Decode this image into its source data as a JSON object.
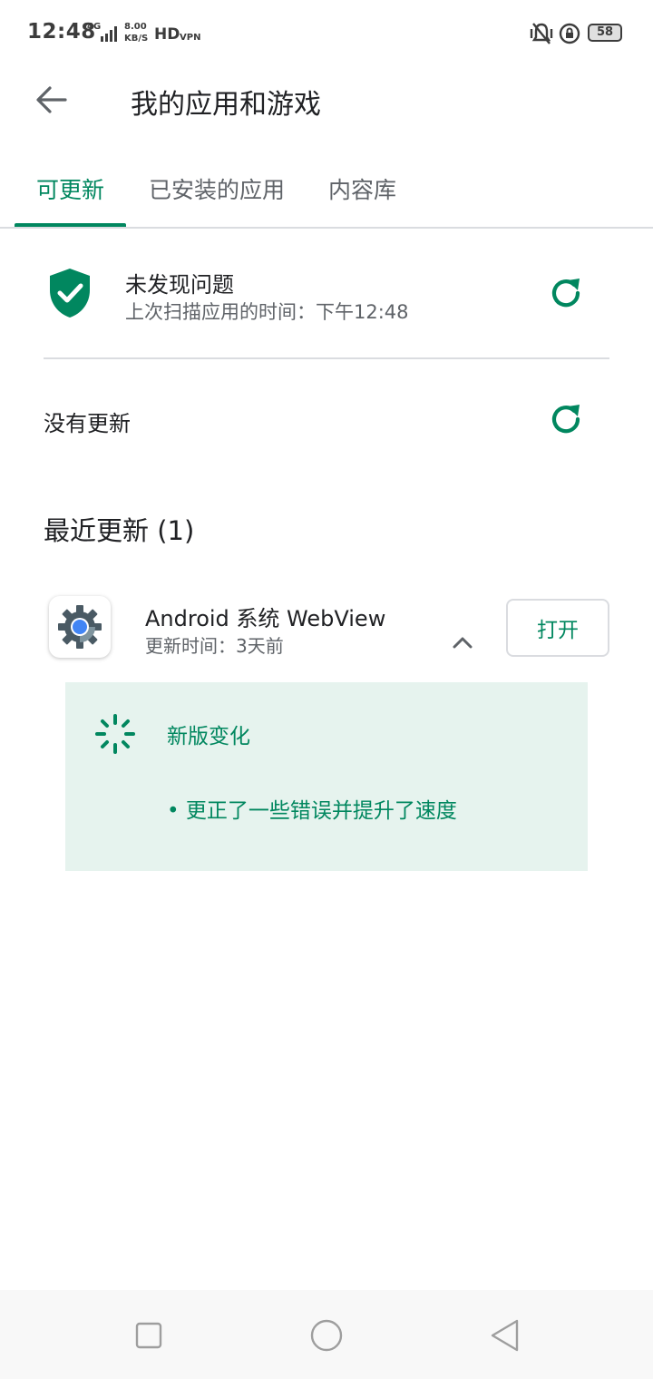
{
  "status_bar": {
    "time": "12:48",
    "network_type": "4G",
    "speed_value": "8.00",
    "speed_unit": "KB/S",
    "hd_label": "HD",
    "vpn_label": "VPN",
    "battery": "58"
  },
  "app_bar": {
    "title": "我的应用和游戏"
  },
  "tabs": [
    {
      "label": "可更新",
      "active": true
    },
    {
      "label": "已安装的应用",
      "active": false
    },
    {
      "label": "内容库",
      "active": false
    }
  ],
  "protect": {
    "title": "未发现问题",
    "subtitle": "上次扫描应用的时间：下午12:48"
  },
  "updates": {
    "status": "没有更新"
  },
  "recent": {
    "title": "最近更新 (1)",
    "apps": [
      {
        "name": "Android 系统 WebView",
        "updated": "更新时间：3天前",
        "open_label": "打开"
      }
    ]
  },
  "changes": {
    "title": "新版变化",
    "item": "• 更正了一些错误并提升了速度"
  },
  "colors": {
    "accent": "#01875f",
    "panel_bg": "#e6f3ee"
  }
}
